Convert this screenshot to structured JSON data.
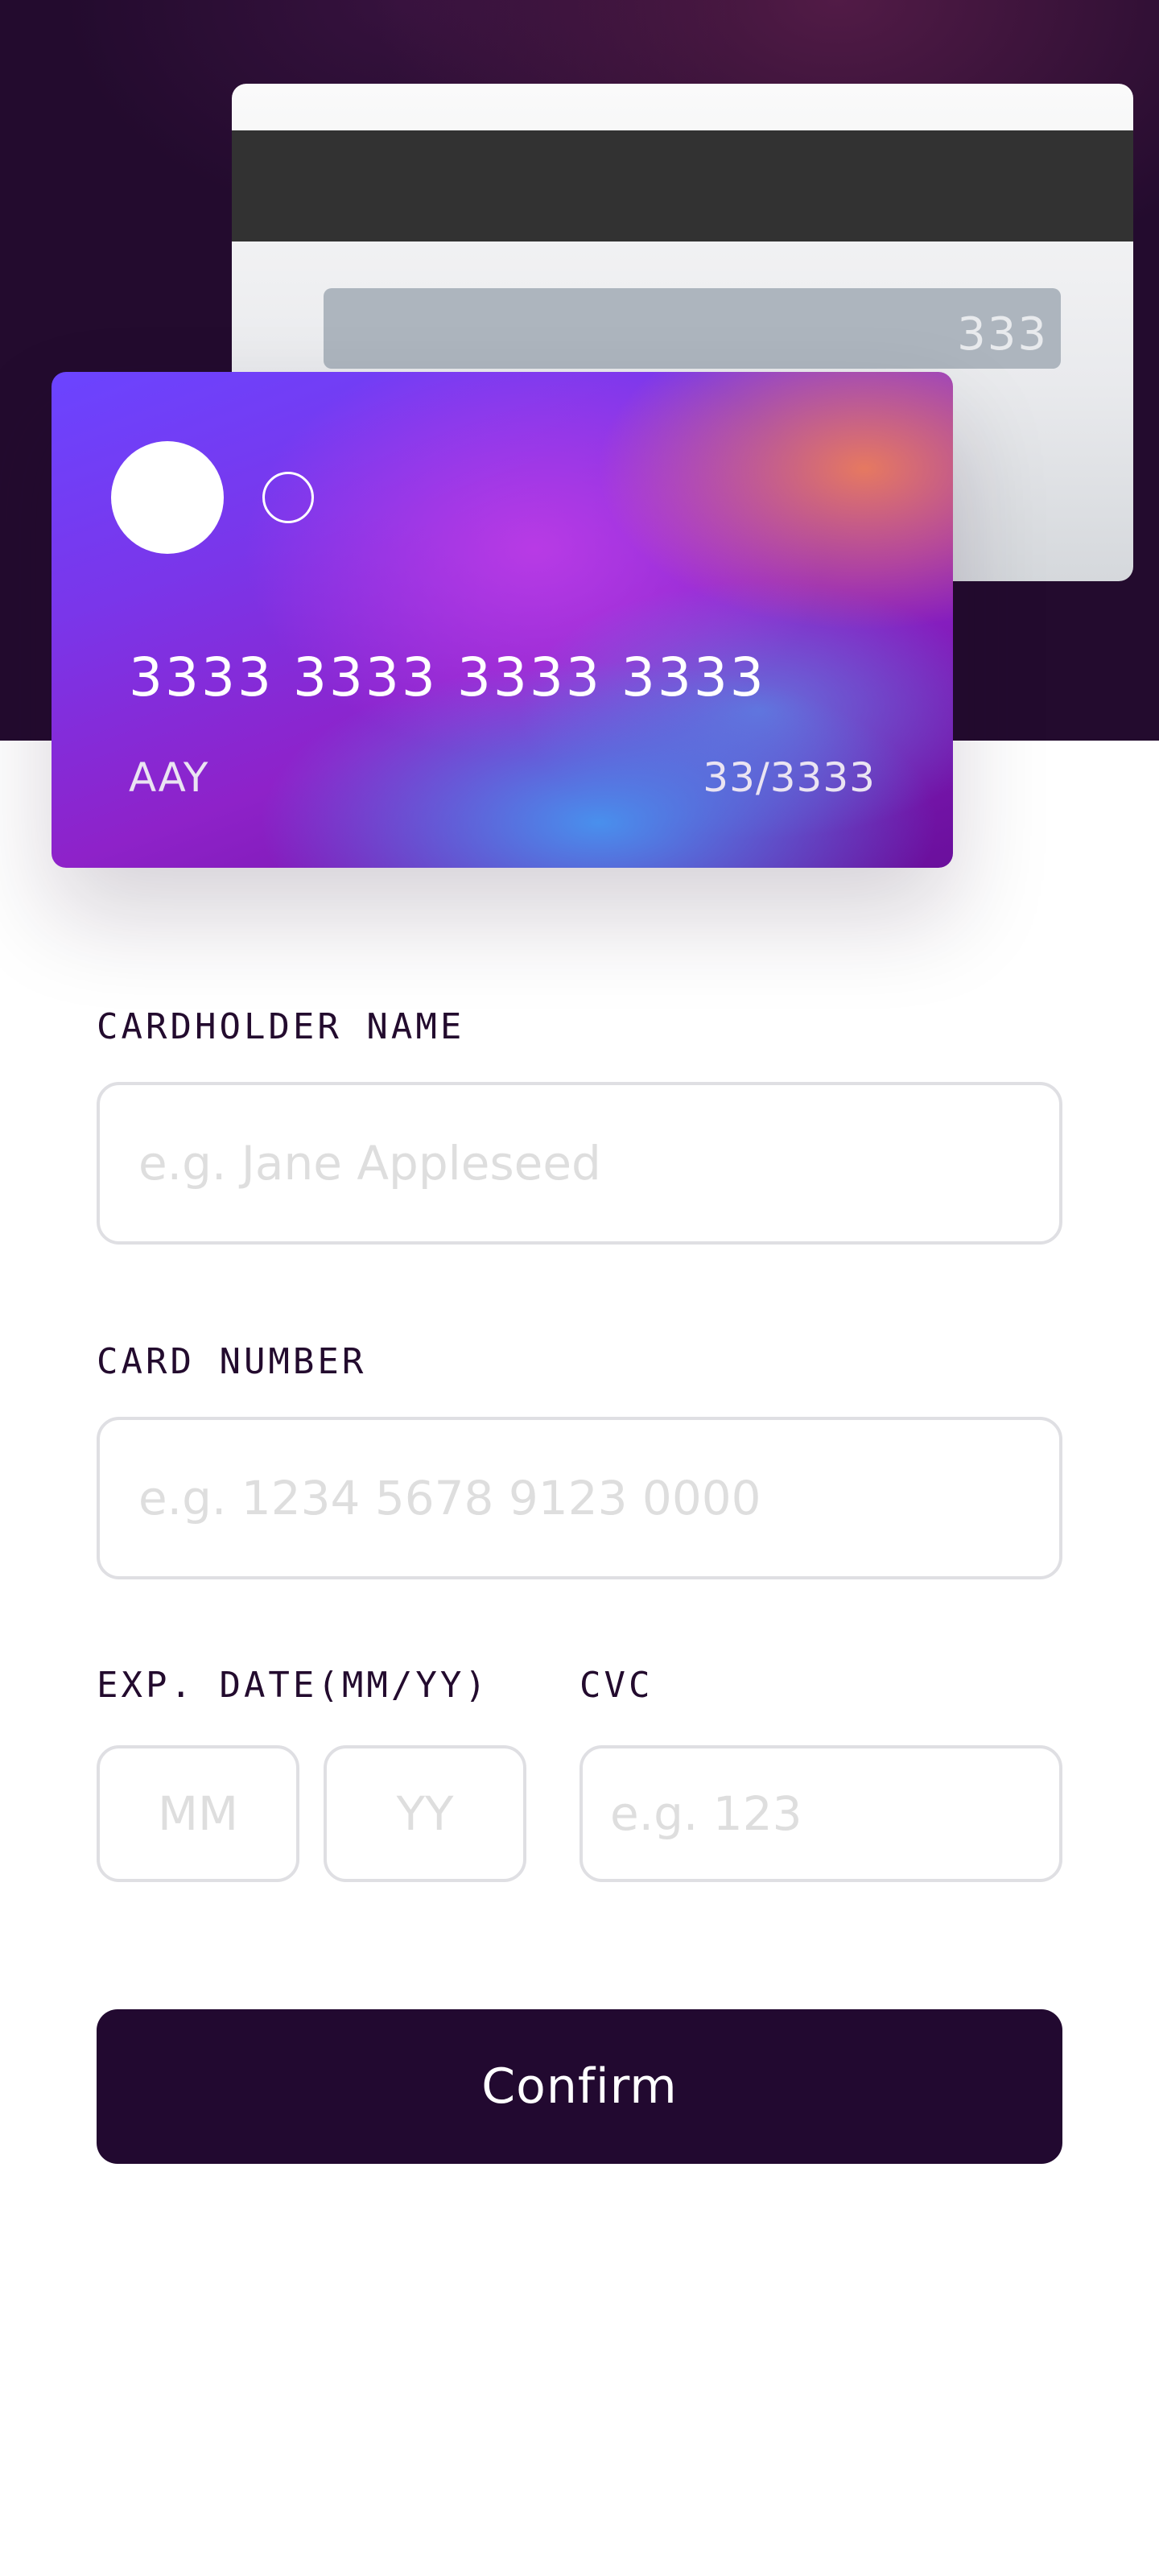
{
  "card": {
    "back": {
      "cvc": "333"
    },
    "front": {
      "number": "3333 3333 3333 3333",
      "holder": "AAY",
      "expiry": "33/3333"
    }
  },
  "form": {
    "name": {
      "label": "CARDHOLDER NAME",
      "placeholder": "e.g. Jane Appleseed"
    },
    "number": {
      "label": "CARD NUMBER",
      "placeholder": "e.g. 1234 5678 9123 0000"
    },
    "exp": {
      "label": "EXP. DATE(MM/YY)",
      "month_placeholder": "MM",
      "year_placeholder": "YY"
    },
    "cvc": {
      "label": "CVC",
      "placeholder": "e.g. 123"
    },
    "submit_label": "Confirm"
  },
  "colors": {
    "dark_violet": "#220930",
    "input_border": "#dfdfe3",
    "placeholder": "#dedede"
  }
}
